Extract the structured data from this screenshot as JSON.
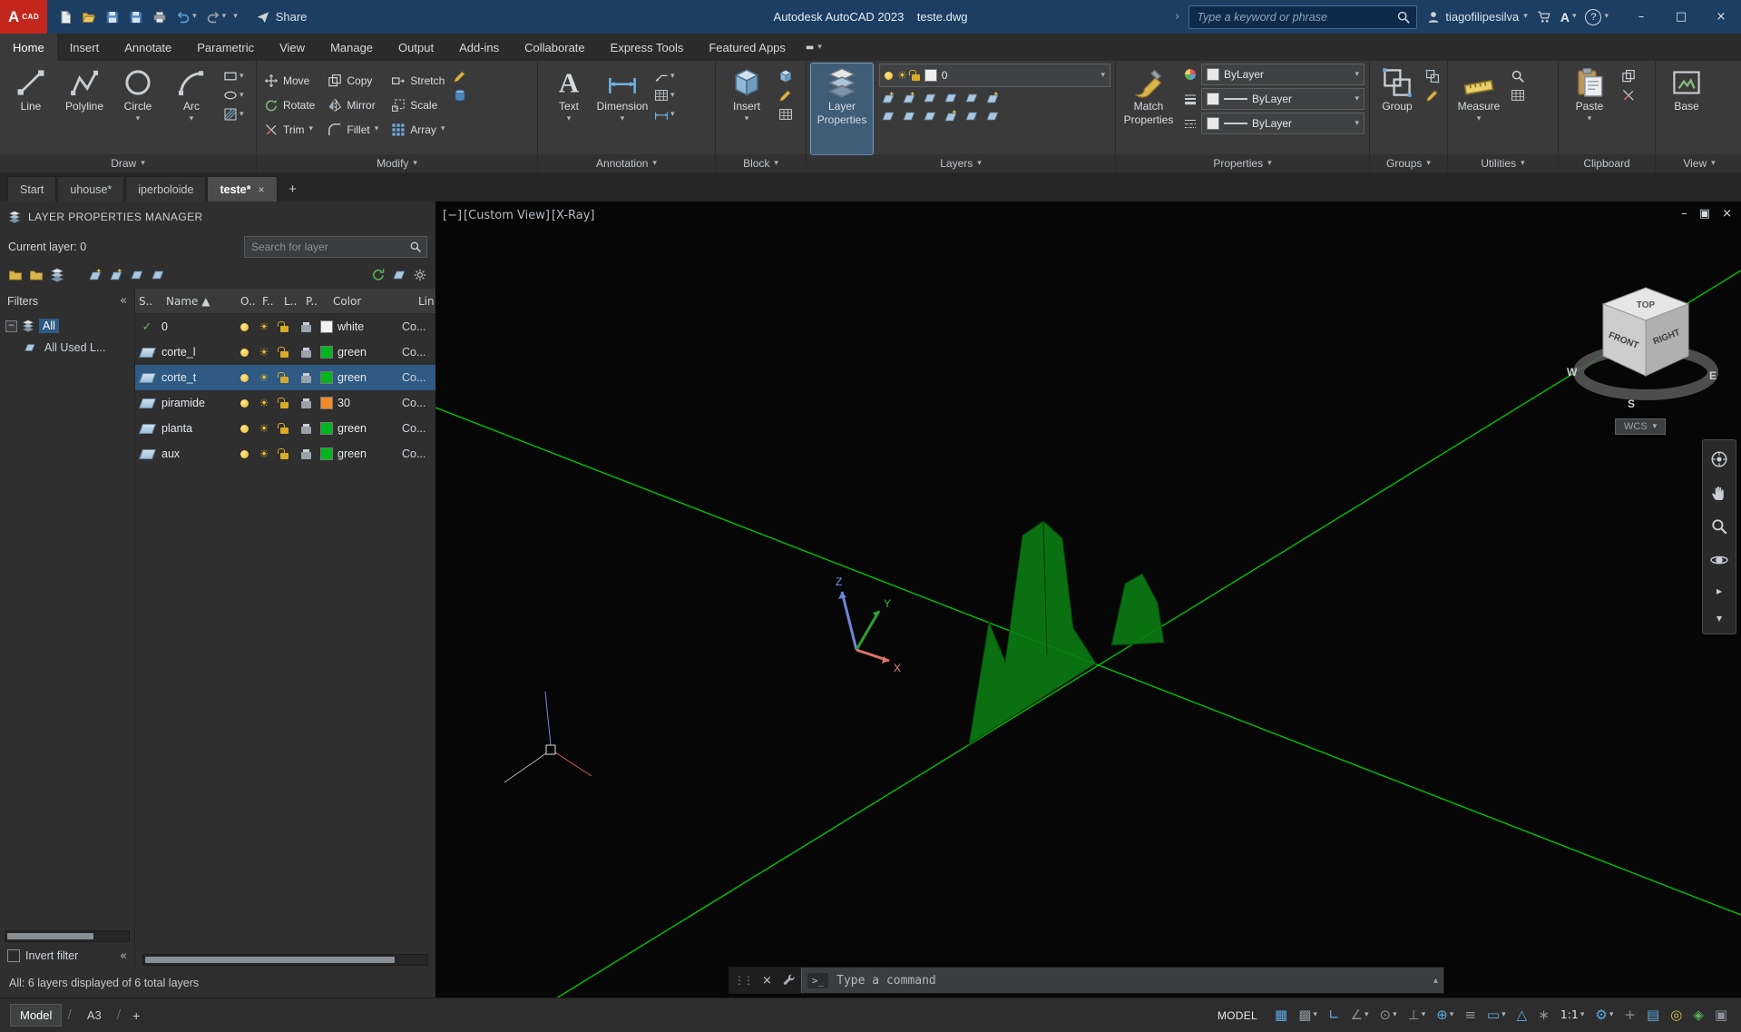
{
  "glyphs": {
    "caret": "▾",
    "caret_up": "▴",
    "collapse": "«",
    "sun": "☀",
    "grip": "⋮⋮",
    "close": "×",
    "minimize": "–",
    "maximize": "□",
    "slash": "/",
    "expander": "−",
    "overflow": "▬",
    "play": "▸",
    "chevron_right": "›"
  },
  "titlebar": {
    "logo_main": "A",
    "logo_sub": "CAD",
    "share_label": "Share",
    "title": "Autodesk AutoCAD 2023    teste.dwg",
    "search_placeholder": "Type a keyword or phrase",
    "user_name": "tiagofilipesilva",
    "app_badge": "A",
    "help_glyph": "?",
    "qat": [
      {
        "icon": "new"
      },
      {
        "icon": "open"
      },
      {
        "icon": "save"
      },
      {
        "icon": "save"
      },
      {
        "icon": "plot"
      },
      {
        "icon": "undo",
        "caret": true
      },
      {
        "icon": "redo",
        "caret": true
      }
    ]
  },
  "ribbon": {
    "tabs": [
      {
        "label": "Home",
        "active": true
      },
      {
        "label": "Insert"
      },
      {
        "label": "Annotate"
      },
      {
        "label": "Parametric"
      },
      {
        "label": "View"
      },
      {
        "label": "Manage"
      },
      {
        "label": "Output"
      },
      {
        "label": "Add-ins"
      },
      {
        "label": "Collaborate"
      },
      {
        "label": "Express Tools"
      },
      {
        "label": "Featured Apps"
      }
    ],
    "panels": {
      "draw": {
        "label": "Draw",
        "big": [
          {
            "label": "Line",
            "icon": "line"
          },
          {
            "label": "Polyline",
            "icon": "polyline"
          },
          {
            "label": "Circle",
            "icon": "circle",
            "flyout": true
          },
          {
            "label": "Arc",
            "icon": "arc",
            "flyout": true
          }
        ],
        "small": [
          {
            "icon": "rect"
          },
          {
            "icon": "ellipse"
          },
          {
            "icon": "hatch"
          }
        ]
      },
      "modify": {
        "label": "Modify",
        "buttons": [
          {
            "label": "Move",
            "icon": "move"
          },
          {
            "label": "Rotate",
            "icon": "rotate"
          },
          {
            "label": "Trim",
            "icon": "trim",
            "flyout": true
          },
          {
            "label": "Copy",
            "icon": "copy"
          },
          {
            "label": "Mirror",
            "icon": "mirror"
          },
          {
            "label": "Fillet",
            "icon": "fillet",
            "flyout": true
          },
          {
            "label": "Stretch",
            "icon": "stretch"
          },
          {
            "label": "Scale",
            "icon": "scale"
          },
          {
            "label": "Array",
            "icon": "array",
            "flyout": true
          }
        ],
        "extra": [
          {
            "icon": "pencil"
          },
          {
            "icon": "cylinder"
          }
        ]
      },
      "annotation": {
        "label": "Annotation",
        "big": [
          {
            "label": "Text",
            "icon": "text",
            "flyout": true
          },
          {
            "label": "Dimension",
            "icon": "dimension",
            "flyout": true
          }
        ],
        "small": [
          {
            "icon": "leader"
          },
          {
            "icon": "tablegrid"
          },
          {
            "icon": "dimension"
          }
        ]
      },
      "block": {
        "label": "Block",
        "big": [
          {
            "label": "Insert",
            "icon": "insertcube",
            "flyout": true
          }
        ],
        "small": [
          {
            "icon": "insertcube"
          },
          {
            "icon": "pencil"
          },
          {
            "icon": "tablegrid"
          }
        ]
      },
      "layers": {
        "label": "Layers",
        "big_label": "Layer Properties",
        "dropdown_value": "0",
        "swatch": "#f0f0f0",
        "tool_icons_1": [
          "lminew",
          "lminew",
          "lmini",
          "lmini",
          "lmini",
          "lminew"
        ],
        "tool_icons_2": [
          "lmini",
          "lmini",
          "lmini",
          "lminew",
          "lmini",
          "lmini"
        ]
      },
      "properties": {
        "label": "Properties",
        "big_label": "Match Properties",
        "rows": [
          {
            "icon": "colorwheel",
            "swatch": true,
            "value": "ByLayer"
          },
          {
            "icon": "lwline",
            "lines": true,
            "value": "ByLayer"
          },
          {
            "icon": "ltline",
            "lines": true,
            "value": "ByLayer"
          }
        ]
      },
      "groups": {
        "label": "Groups",
        "big_label": "Group",
        "small": [
          {
            "icon": "group"
          },
          {
            "icon": "pencil"
          }
        ]
      },
      "utilities": {
        "label": "Utilities",
        "big_label": "Measure",
        "small": [
          {
            "icon": "magnifier"
          },
          {
            "icon": "tablegrid"
          }
        ]
      },
      "clipboard": {
        "label": "Clipboard",
        "big_label": "Paste",
        "small": [
          {
            "icon": "copy"
          },
          {
            "icon": "trim"
          }
        ]
      },
      "view": {
        "label": "View",
        "big_label": "Base"
      }
    }
  },
  "file_tabs": {
    "tabs": [
      {
        "label": "Start"
      },
      {
        "label": "uhouse*"
      },
      {
        "label": "iperboloide"
      },
      {
        "label": "teste*",
        "active": true,
        "close": "×"
      }
    ],
    "add_label": "+"
  },
  "layer_manager": {
    "title": "LAYER PROPERTIES MANAGER",
    "current_layer_label": "Current layer: 0",
    "search_placeholder": "Search for layer",
    "filters_label": "Filters",
    "columns": [
      "S..",
      "Name ▲",
      "O..",
      "F..",
      "L..",
      "P..",
      "Color",
      "Lin"
    ],
    "tree": [
      {
        "label": "All",
        "icon": "layerstack",
        "selected": true,
        "pad": "6px",
        "expander": true
      },
      {
        "label": "All Used L...",
        "icon": "lmini",
        "pad": "26px"
      }
    ],
    "layers": [
      {
        "name": "0",
        "check": "✓",
        "color_hex": "#f2f2f2",
        "color_name": "white",
        "linetype": "Co..."
      },
      {
        "name": "corte_l",
        "sheet": true,
        "color_hex": "#00b51e",
        "color_name": "green",
        "linetype": "Co..."
      },
      {
        "name": "corte_t",
        "sheet": true,
        "selected": true,
        "color_hex": "#00b51e",
        "color_name": "green",
        "linetype": "Co..."
      },
      {
        "name": "piramide",
        "sheet": true,
        "color_hex": "#f08c28",
        "color_name": "30",
        "linetype": "Co..."
      },
      {
        "name": "planta",
        "sheet": true,
        "color_hex": "#00b51e",
        "color_name": "green",
        "linetype": "Co..."
      },
      {
        "name": "aux",
        "sheet": true,
        "color_hex": "#00b51e",
        "color_name": "green",
        "linetype": "Co..."
      }
    ],
    "invert_filter_label": "Invert filter",
    "status_text": "All: 6 layers displayed of 6 total layers"
  },
  "viewport": {
    "controls": [
      "[−]",
      "[Custom View]",
      "[X-Ray]"
    ],
    "window_buttons": [
      {
        "glyph": "–",
        "name": "minimize"
      },
      {
        "glyph": "▣",
        "name": "restore"
      },
      {
        "glyph": "×",
        "name": "close"
      }
    ],
    "viewcube": {
      "top": "TOP",
      "front": "FRONT",
      "right": "RIGHT",
      "west": "W",
      "south": "S",
      "east": "E"
    },
    "wcs_label": "WCS",
    "axes": {
      "x": "X",
      "y": "Y",
      "z": "Z"
    },
    "line_color": "#00c400",
    "solid_color": "#0c7a14"
  },
  "command_line": {
    "prompt": ">_",
    "placeholder": "Type a command"
  },
  "statusbar": {
    "model_tab": "Model",
    "layout_tab": "A3",
    "add_layout": "+",
    "space_label": "MODEL",
    "icons": [
      {
        "name": "grid-display",
        "glyph": "▦",
        "color": "#5ba9e0"
      },
      {
        "name": "snap-mode",
        "glyph": "▩",
        "color": "#8d9299",
        "caret": true
      },
      {
        "name": "ortho-mode",
        "glyph": "∟",
        "color": "#5ba9e0"
      },
      {
        "name": "polar-tracking",
        "glyph": "∠",
        "color": "#8d9299",
        "caret": true
      },
      {
        "name": "isometric-drafting",
        "glyph": "⊙",
        "color": "#8d9299",
        "caret": true
      },
      {
        "name": "object-snap-tracking",
        "glyph": "⊥",
        "color": "#8d9299",
        "caret": true
      },
      {
        "name": "object-snap",
        "glyph": "⊕",
        "color": "#5ba9e0",
        "caret": true
      },
      {
        "name": "lineweight",
        "glyph": "≡",
        "color": "#8d9299"
      },
      {
        "name": "selection-cycling",
        "glyph": "▭",
        "color": "#5ba9e0",
        "caret": true
      },
      {
        "name": "annotation-visibility",
        "glyph": "△",
        "color": "#5ba9e0"
      },
      {
        "name": "autoscale",
        "glyph": "∗",
        "color": "#8d9299"
      },
      {
        "name": "annotation-scale",
        "glyph": "1:1",
        "text": true,
        "color": "#dfe3e6",
        "caret": true
      },
      {
        "name": "workspace-switching",
        "glyph": "⚙",
        "color": "#5ba9e0",
        "caret": true
      },
      {
        "name": "annotation-monitor",
        "glyph": "+",
        "color": "#8d9299"
      },
      {
        "name": "quick-properties",
        "glyph": "▤",
        "color": "#5ba9e0"
      },
      {
        "name": "isolate-objects",
        "glyph": "◎",
        "color": "#d5c04a"
      },
      {
        "name": "graphics-performance",
        "glyph": "◈",
        "color": "#58b058"
      },
      {
        "name": "clean-screen",
        "glyph": "▣",
        "color": "#8d9299"
      }
    ]
  }
}
